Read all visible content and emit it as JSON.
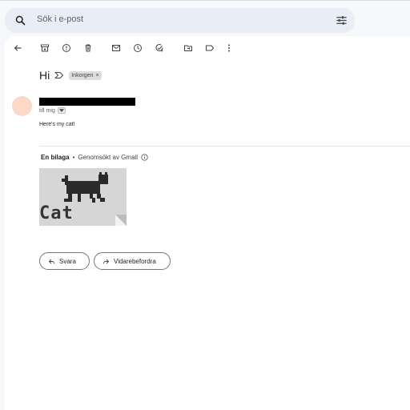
{
  "search": {
    "placeholder": "Sök i e-post"
  },
  "toolbar": {
    "icons": [
      "back-arrow-icon",
      "archive-icon",
      "report-spam-icon",
      "delete-icon",
      "mark-unread-icon",
      "snooze-icon",
      "add-task-icon",
      "move-to-icon",
      "label-icon",
      "more-icon"
    ]
  },
  "message": {
    "subject": "Hi",
    "label_chip": "Inkorgen",
    "label_chip_close": "×",
    "to_text": "till mig",
    "body": "Here's my cat!"
  },
  "attachments": {
    "count_text": "En bilaga",
    "separator": "•",
    "scan_text": "Genomsökt av Gmail",
    "thumbnail_caption": "Cat"
  },
  "actions": {
    "reply_label": "Svara",
    "forward_label": "Vidarebefordra"
  },
  "colors": {
    "avatar": "#fbd9c8",
    "search_bg": "#e9eef6",
    "page_bg": "#f6f8fc"
  }
}
